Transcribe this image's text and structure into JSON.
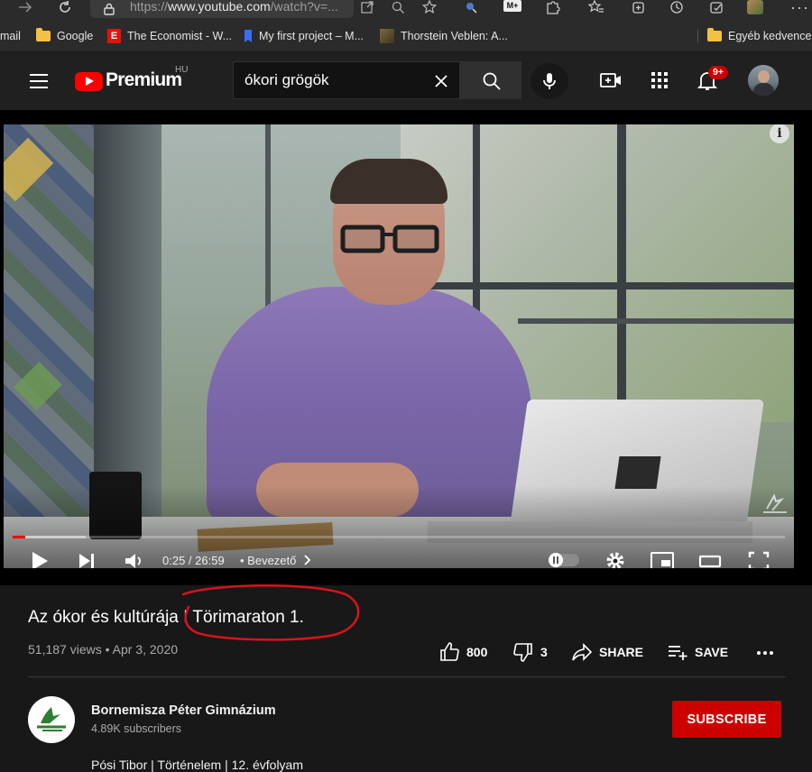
{
  "browser": {
    "url_prefix": "https://",
    "url_host": "www.youtube.com",
    "url_path": "/watch?v=...",
    "bookmarks": [
      {
        "label": "mail",
        "icon": "mail"
      },
      {
        "label": "Google",
        "icon": "folder-icon"
      },
      {
        "label": "The Economist - W...",
        "icon": "economist-icon"
      },
      {
        "label": "My first project – M...",
        "icon": "bookmark-icon"
      },
      {
        "label": "Thorstein Veblen: A...",
        "icon": "veblen-icon"
      },
      {
        "label": "Egyéb kedvencek",
        "icon": "folder-icon"
      }
    ],
    "extension_label": "M+"
  },
  "header": {
    "logo_text": "Premium",
    "region": "HU",
    "search_value": "ókori grögök",
    "notification_count": "9+"
  },
  "player": {
    "current_time": "0:25",
    "duration": "26:59",
    "time_display": "0:25 / 26:59",
    "chapter": "• Bevezető",
    "progress_fraction": 0.016,
    "buffered_fraction": 0.095,
    "info_label": "i"
  },
  "video": {
    "title": "Az ókor és kultúrája I Törimaraton 1.",
    "meta": "51,187 views • Apr 3, 2020",
    "likes": "800",
    "dislikes": "3",
    "share_label": "SHARE",
    "save_label": "SAVE"
  },
  "channel": {
    "name": "Bornemisza Péter Gimnázium",
    "subscribers": "4.89K subscribers",
    "subscribe_label": "SUBSCRIBE"
  },
  "description": {
    "first_line": "Pósi Tibor | Történelem | 12. évfolyam"
  },
  "colors": {
    "brand_red": "#ff0000",
    "subscribe_red": "#cc0000",
    "background": "#181818",
    "annotation_red": "#d8131b"
  }
}
